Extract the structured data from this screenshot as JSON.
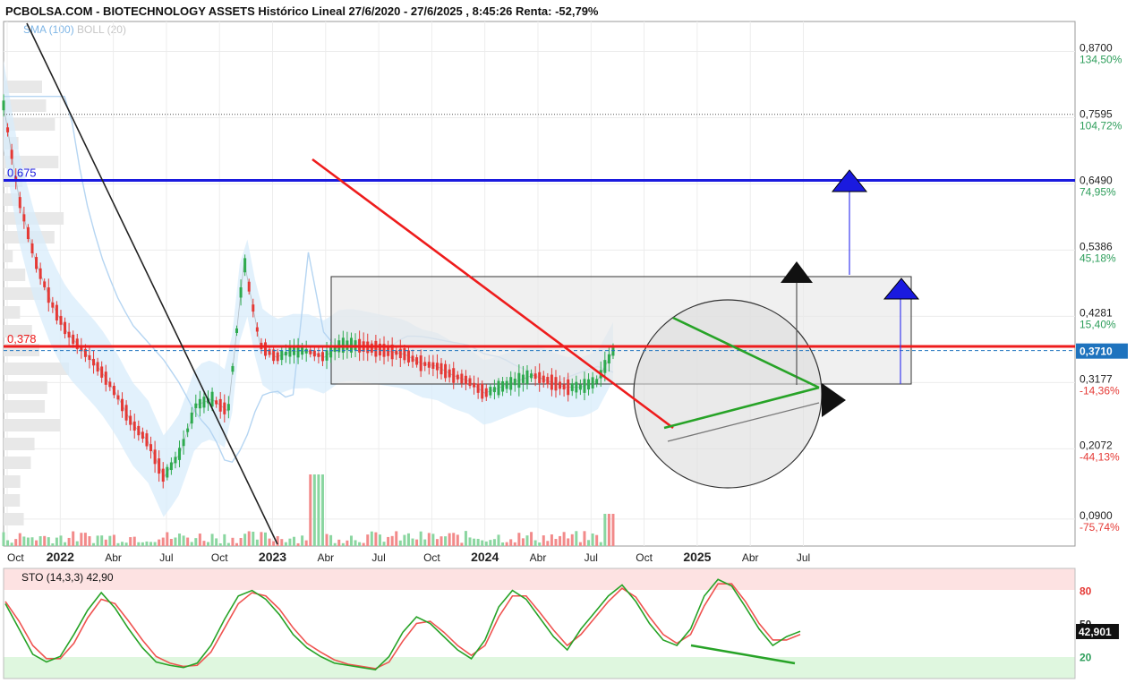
{
  "header": {
    "title": "PCBOLSA.COM - BIOTECHNOLOGY ASSETS Histórico Lineal 27/6/2020 - 27/6/2025 , 8:45:26 Renta: -52,79%",
    "indicator_sma": "SMA (100)",
    "indicator_boll": "BOLL (20)",
    "sto_label": "STO (14,3,3)   42,90"
  },
  "colors": {
    "up_candle": "#2eaa4e",
    "down_candle": "#e53935",
    "resistance_blue": "#1a1adf",
    "support_red": "#ee1c1c",
    "bollinger_fill": "#d8ecfb",
    "sto_k": "#27a327",
    "sto_d": "#ef5350",
    "current_price_box": "#1e73be"
  },
  "chart_data": [
    {
      "type": "line",
      "title": "PCBOLSA.COM - BIOTECHNOLOGY ASSETS Histórico Lineal 27/6/2020 - 27/6/2025 , 8:45:26 Renta: -52,79%",
      "x_tick_labels": [
        "Oct",
        "2022",
        "Abr",
        "Jul",
        "Oct",
        "2023",
        "Abr",
        "Jul",
        "Oct",
        "2024",
        "Abr",
        "Jul",
        "Oct",
        "2025",
        "Abr",
        "Jul"
      ],
      "y_ticks": [
        {
          "price": "0,8700",
          "pct": "134,50%"
        },
        {
          "price": "0,7595",
          "pct": "104,72%"
        },
        {
          "price": "0,6490",
          "pct": "74,95%"
        },
        {
          "price": "0,5386",
          "pct": "45,18%"
        },
        {
          "price": "0,4281",
          "pct": "15,40%"
        },
        {
          "price": "0,3177",
          "pct": "-14,36%"
        },
        {
          "price": "0,2072",
          "pct": "-44,13%"
        },
        {
          "price": "0,0900",
          "pct": "-75,74%"
        }
      ],
      "ylim": [
        0.045,
        0.92
      ],
      "current_price": "0,3710",
      "horizontal_levels": [
        {
          "label": "0,675",
          "value": 0.655
        },
        {
          "label": "0,378",
          "value": 0.378
        }
      ],
      "dotted_level": 0.765,
      "series": [
        {
          "name": "Precio",
          "x": [
            0,
            0.02,
            0.04,
            0.06,
            0.08,
            0.1,
            0.12,
            0.14,
            0.16,
            0.18,
            0.2,
            0.22,
            0.24,
            0.26,
            0.28,
            0.3,
            0.32,
            0.34,
            0.36,
            0.38,
            0.4,
            0.42,
            0.44,
            0.46,
            0.48,
            0.5,
            0.52,
            0.54,
            0.56,
            0.58,
            0.6,
            0.62,
            0.64,
            0.66,
            0.68,
            0.7,
            0.72,
            0.74,
            0.76
          ],
          "values": [
            0.78,
            0.62,
            0.52,
            0.45,
            0.4,
            0.37,
            0.34,
            0.3,
            0.25,
            0.22,
            0.16,
            0.2,
            0.28,
            0.29,
            0.27,
            0.52,
            0.38,
            0.36,
            0.37,
            0.37,
            0.36,
            0.38,
            0.38,
            0.375,
            0.37,
            0.365,
            0.35,
            0.345,
            0.33,
            0.32,
            0.3,
            0.31,
            0.32,
            0.33,
            0.32,
            0.31,
            0.31,
            0.32,
            0.37
          ]
        }
      ]
    },
    {
      "type": "line",
      "title": "STO (14,3,3)",
      "y_ticks": [
        80,
        50,
        20
      ],
      "ylim": [
        0,
        100
      ],
      "current_value": "42,901",
      "series": [
        {
          "name": "%K",
          "values": [
            68,
            45,
            22,
            15,
            20,
            40,
            62,
            78,
            64,
            45,
            28,
            15,
            12,
            10,
            14,
            30,
            54,
            75,
            80,
            72,
            58,
            40,
            28,
            20,
            14,
            12,
            10,
            8,
            20,
            42,
            56,
            50,
            38,
            26,
            18,
            35,
            65,
            80,
            72,
            55,
            38,
            26,
            45,
            60,
            75,
            85,
            70,
            50,
            35,
            30,
            45,
            75,
            90,
            84,
            65,
            45,
            30,
            38,
            42.9
          ]
        },
        {
          "name": "%D",
          "values": [
            70,
            52,
            30,
            18,
            18,
            32,
            55,
            72,
            68,
            52,
            35,
            20,
            14,
            11,
            12,
            24,
            46,
            68,
            78,
            75,
            63,
            46,
            32,
            24,
            17,
            13,
            11,
            9,
            15,
            34,
            50,
            52,
            42,
            30,
            21,
            30,
            56,
            75,
            75,
            60,
            44,
            30,
            40,
            55,
            70,
            82,
            74,
            56,
            40,
            32,
            40,
            66,
            86,
            86,
            70,
            50,
            35,
            35,
            40
          ]
        }
      ]
    }
  ]
}
